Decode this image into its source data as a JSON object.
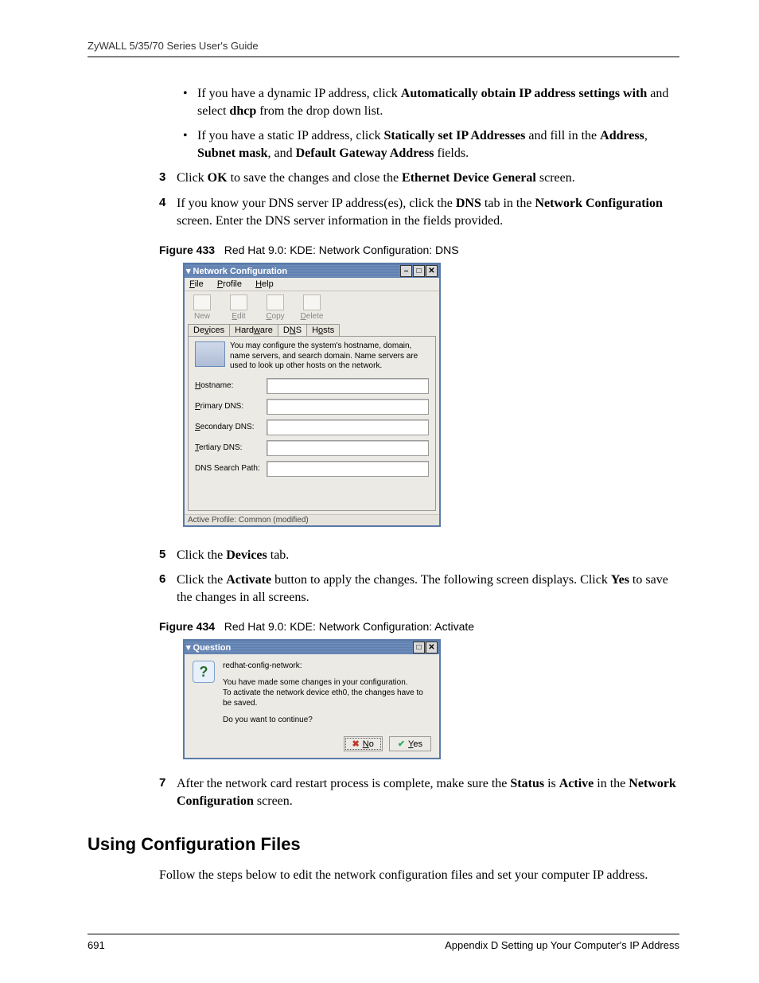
{
  "header": {
    "title": "ZyWALL 5/35/70 Series User's Guide"
  },
  "bullets": {
    "b1_pre": "If you have a dynamic IP address, click ",
    "b1_bold1": "Automatically obtain IP address settings with",
    "b1_mid": " and select ",
    "b1_bold2": "dhcp",
    "b1_post": " from the drop down list.",
    "b2_pre": "If you have a static IP address, click ",
    "b2_bold1": "Statically set IP Addresses",
    "b2_mid1": " and fill in the  ",
    "b2_bold2": "Address",
    "b2_sep1": ", ",
    "b2_bold3": "Subnet mask",
    "b2_sep2": ", and ",
    "b2_bold4": "Default Gateway Address",
    "b2_post": " fields."
  },
  "steps": {
    "s3": {
      "num": "3",
      "t1": "Click ",
      "b1": "OK",
      "t2": " to save the changes and close the ",
      "b2": "Ethernet Device General",
      "t3": " screen."
    },
    "s4": {
      "num": "4",
      "t1": "If you know your DNS server IP address(es), click the ",
      "b1": "DNS",
      "t2": " tab in the ",
      "b2": "Network Configuration",
      "t3": " screen. Enter the DNS server information in the fields provided."
    },
    "s5": {
      "num": "5",
      "t1": "Click the ",
      "b1": "Devices",
      "t2": " tab."
    },
    "s6": {
      "num": "6",
      "t1": "Click the ",
      "b1": "Activate",
      "t2": " button to apply the changes. The following screen displays. Click ",
      "b2": "Yes",
      "t3": " to save the changes in all screens."
    },
    "s7": {
      "num": "7",
      "t1": "After the network card restart process is complete, make sure the ",
      "b1": "Status",
      "t2": " is ",
      "b2": "Active",
      "t3": " in the ",
      "b3": "Network Configuration",
      "t4": " screen."
    }
  },
  "fig433": {
    "label": "Figure 433",
    "caption": "Red Hat 9.0: KDE: Network Configuration: DNS",
    "win": {
      "title": "Network Configuration",
      "menu": {
        "file": "File",
        "profile": "Profile",
        "help": "Help"
      },
      "tools": {
        "new": "New",
        "edit": "Edit",
        "copy": "Copy",
        "delete": "Delete"
      },
      "tabs": {
        "devices": "Devices",
        "hardware": "Hardware",
        "dns": "DNS",
        "hosts": "Hosts"
      },
      "desc": "You may configure the system's hostname, domain, name servers, and search domain. Name servers are used to look up other hosts on the network.",
      "fields": {
        "hostname": "Hostname:",
        "primary": "Primary DNS:",
        "secondary": "Secondary DNS:",
        "tertiary": "Tertiary DNS:",
        "search": "DNS Search Path:"
      },
      "status": "Active Profile: Common (modified)"
    }
  },
  "fig434": {
    "label": "Figure 434",
    "caption": "Red Hat 9.0: KDE: Network Configuration: Activate",
    "dlg": {
      "title": "Question",
      "line1": "redhat-config-network:",
      "line2": "You have made some changes in your configuration.",
      "line3": "To activate the network device eth0, the changes have to be saved.",
      "line4": "Do you want to continue?",
      "no": "No",
      "yes": "Yes"
    }
  },
  "section": {
    "heading": "Using Configuration Files",
    "para": "Follow the steps below to edit the network configuration files and set your computer IP address."
  },
  "footer": {
    "page": "691",
    "text": "Appendix D Setting up Your Computer's IP Address"
  }
}
